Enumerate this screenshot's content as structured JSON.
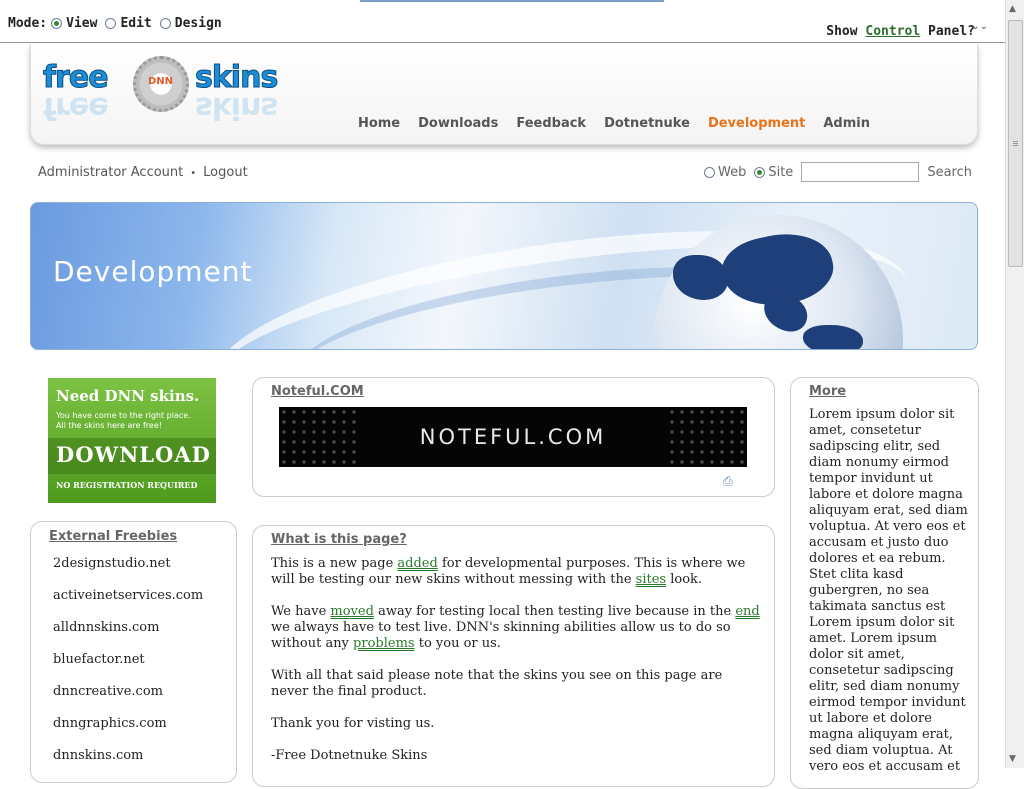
{
  "control_bar": {
    "mode_label": "Mode:",
    "modes": [
      {
        "label": "View",
        "selected": true
      },
      {
        "label": "Edit",
        "selected": false
      },
      {
        "label": "Design",
        "selected": false
      }
    ],
    "show_prefix": "Show ",
    "control_word": "Control",
    "show_suffix": " Panel?",
    "toggle_glyph": "⌄⌄"
  },
  "logo": {
    "left": "free",
    "right": "skins",
    "center": "DNN"
  },
  "nav": [
    "Home",
    "Downloads",
    "Feedback",
    "Dotnetnuke",
    "Development",
    "Admin"
  ],
  "nav_active": "Development",
  "account": {
    "user": "Administrator Account",
    "separator": "•",
    "logout": "Logout"
  },
  "search": {
    "options": [
      {
        "label": "Web",
        "selected": false
      },
      {
        "label": "Site",
        "selected": true
      }
    ],
    "value": "",
    "button": "Search"
  },
  "banner": {
    "title": "Development"
  },
  "ad": {
    "heading": "Need DNN skins.",
    "line1": "You have come to the right place.",
    "line2": "All the skins here are free!",
    "cta": "DOWNLOAD",
    "footer": "NO REGISTRATION REQUIRED"
  },
  "external": {
    "title": "External Freebies",
    "links": [
      "2designstudio.net",
      "activeinetservices.com",
      "alldnnskins.com",
      "bluefactor.net",
      "dnncreative.com",
      "dnngraphics.com",
      "dnnskins.com"
    ]
  },
  "noteful": {
    "title": "Noteful.COM",
    "banner_text": "NOTEFUL.COM"
  },
  "what": {
    "title": "What is this page?",
    "p1a": "This is a new page ",
    "p1_link1": "added",
    "p1b": " for developmental purposes. This is where we will be testing our new skins without messing with the ",
    "p1_link2": "sites",
    "p1c": " look.",
    "p2a": "We have ",
    "p2_link1": "moved",
    "p2b": " away for testing local then testing live because in the ",
    "p2_link2": "end",
    "p2c": " we always have to test live. DNN's skinning abilities allow us to do so without any ",
    "p2_link3": "problems",
    "p2d": " to you or us.",
    "p3": "With all that said please note that the skins you see on this page are never the final product.",
    "p4": "Thank you for visting us.",
    "p5": "-Free Dotnetnuke Skins"
  },
  "more": {
    "title": "More",
    "text": "Lorem ipsum dolor sit amet, consetetur sadipscing elitr, sed diam nonumy eirmod tempor invidunt ut labore et dolore magna aliquyam erat, sed diam voluptua. At vero eos et accusam et justo duo dolores et ea rebum. Stet clita kasd gubergren, no sea takimata sanctus est Lorem ipsum dolor sit amet. Lorem ipsum dolor sit amet, consetetur sadipscing elitr, sed diam nonumy eirmod tempor invidunt ut labore et dolore magna aliquyam erat, sed diam voluptua. At vero eos et accusam et"
  },
  "colors": {
    "accent_orange": "#e8731a",
    "link_green": "#2a7a2a",
    "brand_blue": "#1d8ed6"
  }
}
